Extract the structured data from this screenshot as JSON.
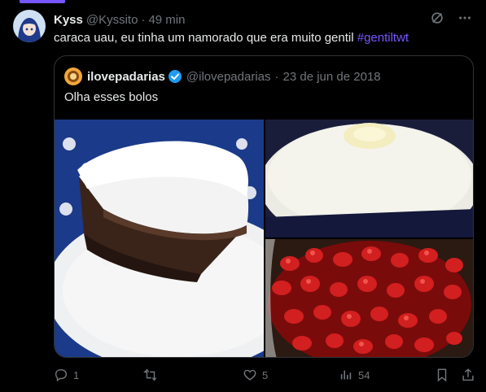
{
  "author": {
    "name": "Kyss",
    "handle": "@Kyssito",
    "separator": "·",
    "time": "49 min"
  },
  "tweet": {
    "text": "caraca uau, eu tinha um namorado que era muito gentil ",
    "hashtag": "#gentiltwt"
  },
  "quoted": {
    "name": "ilovepadarias",
    "handle": "@ilovepadarias",
    "separator": "·",
    "date": "23 de jun de 2018",
    "text": "Olha esses bolos"
  },
  "actions": {
    "replies": "1",
    "retweets": "",
    "likes": "5",
    "views": "54"
  },
  "icons": {
    "header": [
      "grok-icon",
      "more-icon"
    ],
    "actions": [
      "reply-icon",
      "retweet-icon",
      "like-icon",
      "views-icon",
      "bookmark-icon",
      "share-icon"
    ]
  },
  "colors": {
    "accent": "#7856ff",
    "verified": "#1d9bf0",
    "muted": "#71767b",
    "text": "#e7e9ea",
    "border": "#2f3336",
    "background": "#000000"
  }
}
